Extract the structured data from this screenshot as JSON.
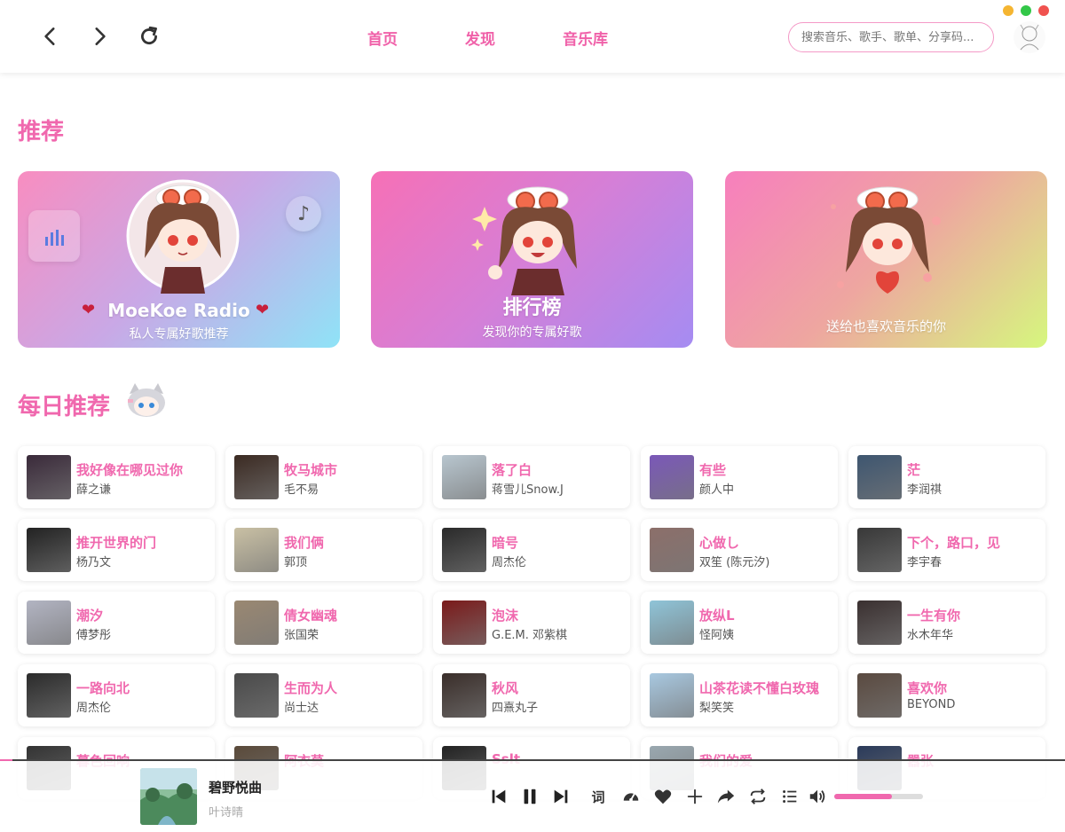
{
  "window": {
    "dots": [
      "#f5b531",
      "#33c748",
      "#f0524f"
    ]
  },
  "topbar": {
    "nav": [
      "首页",
      "发现",
      "音乐库"
    ],
    "search_placeholder": "搜索音乐、歌手、歌单、分享码..."
  },
  "sections": {
    "recommend": "推荐",
    "daily": "每日推荐"
  },
  "banners": [
    {
      "title": "MoeKoe Radio",
      "subtitle": "私人专属好歌推荐"
    },
    {
      "title": "排行榜",
      "subtitle": "发现你的专属好歌"
    },
    {
      "title": "",
      "subtitle": "送给也喜欢音乐的你"
    }
  ],
  "songs": [
    {
      "title": "我好像在哪见过你",
      "artist": "薛之谦",
      "cover": "#3a2a3a"
    },
    {
      "title": "牧马城市",
      "artist": "毛不易",
      "cover": "#3b2a22"
    },
    {
      "title": "落了白",
      "artist": "蒋雪儿Snow.J",
      "cover": "#b8c6cf"
    },
    {
      "title": "有些",
      "artist": "颜人中",
      "cover": "#7a58b8"
    },
    {
      "title": "茫",
      "artist": "李润祺",
      "cover": "#3e5670"
    },
    {
      "title": "推开世界的门",
      "artist": "杨乃文",
      "cover": "#222222"
    },
    {
      "title": "我们俩",
      "artist": "郭顶",
      "cover": "#c9c0a4"
    },
    {
      "title": "暗号",
      "artist": "周杰伦",
      "cover": "#2a2a2a"
    },
    {
      "title": "心做し",
      "artist": "双笙 (陈元汐)",
      "cover": "#8c6f6a"
    },
    {
      "title": "下个，路口，见",
      "artist": "李宇春",
      "cover": "#383838"
    },
    {
      "title": "潮汐",
      "artist": "傅梦彤",
      "cover": "#b2b4c2"
    },
    {
      "title": "倩女幽魂",
      "artist": "张国荣",
      "cover": "#9a8872"
    },
    {
      "title": "泡沫",
      "artist": "G.E.M. 邓紫棋",
      "cover": "#7a1a1a"
    },
    {
      "title": "放纵L",
      "artist": "怪阿姨",
      "cover": "#8fc4d8"
    },
    {
      "title": "一生有你",
      "artist": "水木年华",
      "cover": "#3a3030"
    },
    {
      "title": "一路向北",
      "artist": "周杰伦",
      "cover": "#2b2b2b"
    },
    {
      "title": "生而为人",
      "artist": "尚士达",
      "cover": "#4a4a4a"
    },
    {
      "title": "秋风",
      "artist": "四熹丸子",
      "cover": "#3a2e2a"
    },
    {
      "title": "山茶花读不懂白玫瑰",
      "artist": "梨笑笑",
      "cover": "#a8c8e0"
    },
    {
      "title": "喜欢你",
      "artist": "BEYOND",
      "cover": "#5a4a40"
    },
    {
      "title": "暮色回响",
      "artist": "",
      "cover": "#333333"
    },
    {
      "title": "阿衣莫",
      "artist": "",
      "cover": "#5a4a3a"
    },
    {
      "title": "Sslt",
      "artist": "",
      "cover": "#222222"
    },
    {
      "title": "我们的爱",
      "artist": "",
      "cover": "#9aa8b0"
    },
    {
      "title": "嚣张",
      "artist": "",
      "cover": "#2a3a5a"
    }
  ],
  "player": {
    "title": "碧野悦曲",
    "artist": "叶诗晴",
    "lyric_label": "词",
    "progress": 0.012,
    "volume": 0.65
  }
}
